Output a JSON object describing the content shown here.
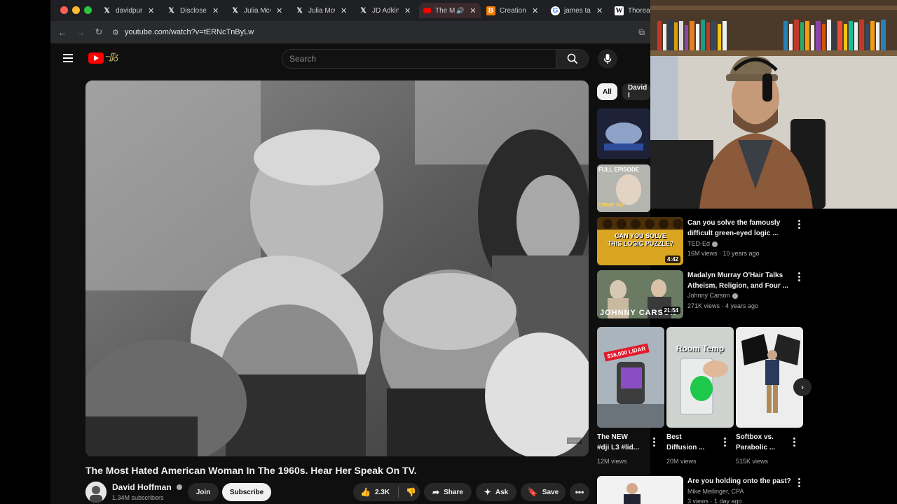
{
  "browser": {
    "tabs": [
      {
        "title": "davidpun",
        "icon": "x-logo-icon",
        "active": false
      },
      {
        "title": "Disclose",
        "icon": "x-logo-icon",
        "active": false
      },
      {
        "title": "Julia McC",
        "icon": "x-logo-icon",
        "active": false
      },
      {
        "title": "Julia McC",
        "icon": "x-logo-icon",
        "active": false
      },
      {
        "title": "JD Adkins",
        "icon": "x-logo-icon",
        "active": false
      },
      {
        "title": "The M",
        "icon": "youtube-icon",
        "active": true
      },
      {
        "title": "Creation",
        "icon": "blogger-icon",
        "active": false
      },
      {
        "title": "james tal",
        "icon": "google-icon",
        "active": false
      },
      {
        "title": "Thorea",
        "icon": "wikipedia-icon",
        "active": false
      }
    ],
    "url": "youtube.com/watch?v=tERNcTnByLw"
  },
  "header": {
    "search_placeholder": "Search"
  },
  "video": {
    "title": "The Most Hated American Woman In The 1960s. Hear Her Speak On TV.",
    "channel": "David Hoffman",
    "subscribers": "1.34M subscribers",
    "join_label": "Join",
    "subscribe_label": "Subscribe",
    "likes": "2.3K",
    "share_label": "Share",
    "ask_label": "Ask",
    "save_label": "Save"
  },
  "chips": [
    "All",
    "David I"
  ],
  "recommendations": [
    {
      "title_line1": "Can you solve the famously",
      "title_line2": "difficult green-eyed logic ...",
      "channel": "TED-Ed",
      "meta": "16M views · 10 years ago",
      "duration": "4:42",
      "thumb_text": "CAN YOU SOLVE THIS LOGIC PUZZLE?"
    },
    {
      "title_line1": "Madalyn Murray O'Hair Talks",
      "title_line2": "Atheism, Religion, and Four ...",
      "channel": "Johnny Carson",
      "meta": "271K views · 4 years ago",
      "duration": "21:54",
      "thumb_text": "JOHNNY CARSON"
    },
    {
      "title_line1": "Are you holding onto the past?",
      "title_line2": "",
      "channel": "Mike Meilinger, CPA",
      "meta": "3 views · 1 day ago"
    }
  ],
  "partial_thumbs": [
    {
      "label": "FULL EPISODE"
    },
    {
      "label": "CRIME 360"
    }
  ],
  "shorts": [
    {
      "title_line1": "The NEW",
      "title_line2": "#dji L3 #lid...",
      "views": "12M views",
      "thumb_text": "$16,000 LIDAR"
    },
    {
      "title_line1": "Best",
      "title_line2": "Diffusion ...",
      "views": "20M views",
      "thumb_text": "Room Temp"
    },
    {
      "title_line1": "Softbox vs.",
      "title_line2": "Parabolic ...",
      "views": "515K views",
      "thumb_text": ""
    }
  ],
  "colors": {
    "accent_red": "#ff0000",
    "background": "#0f0f0f"
  }
}
